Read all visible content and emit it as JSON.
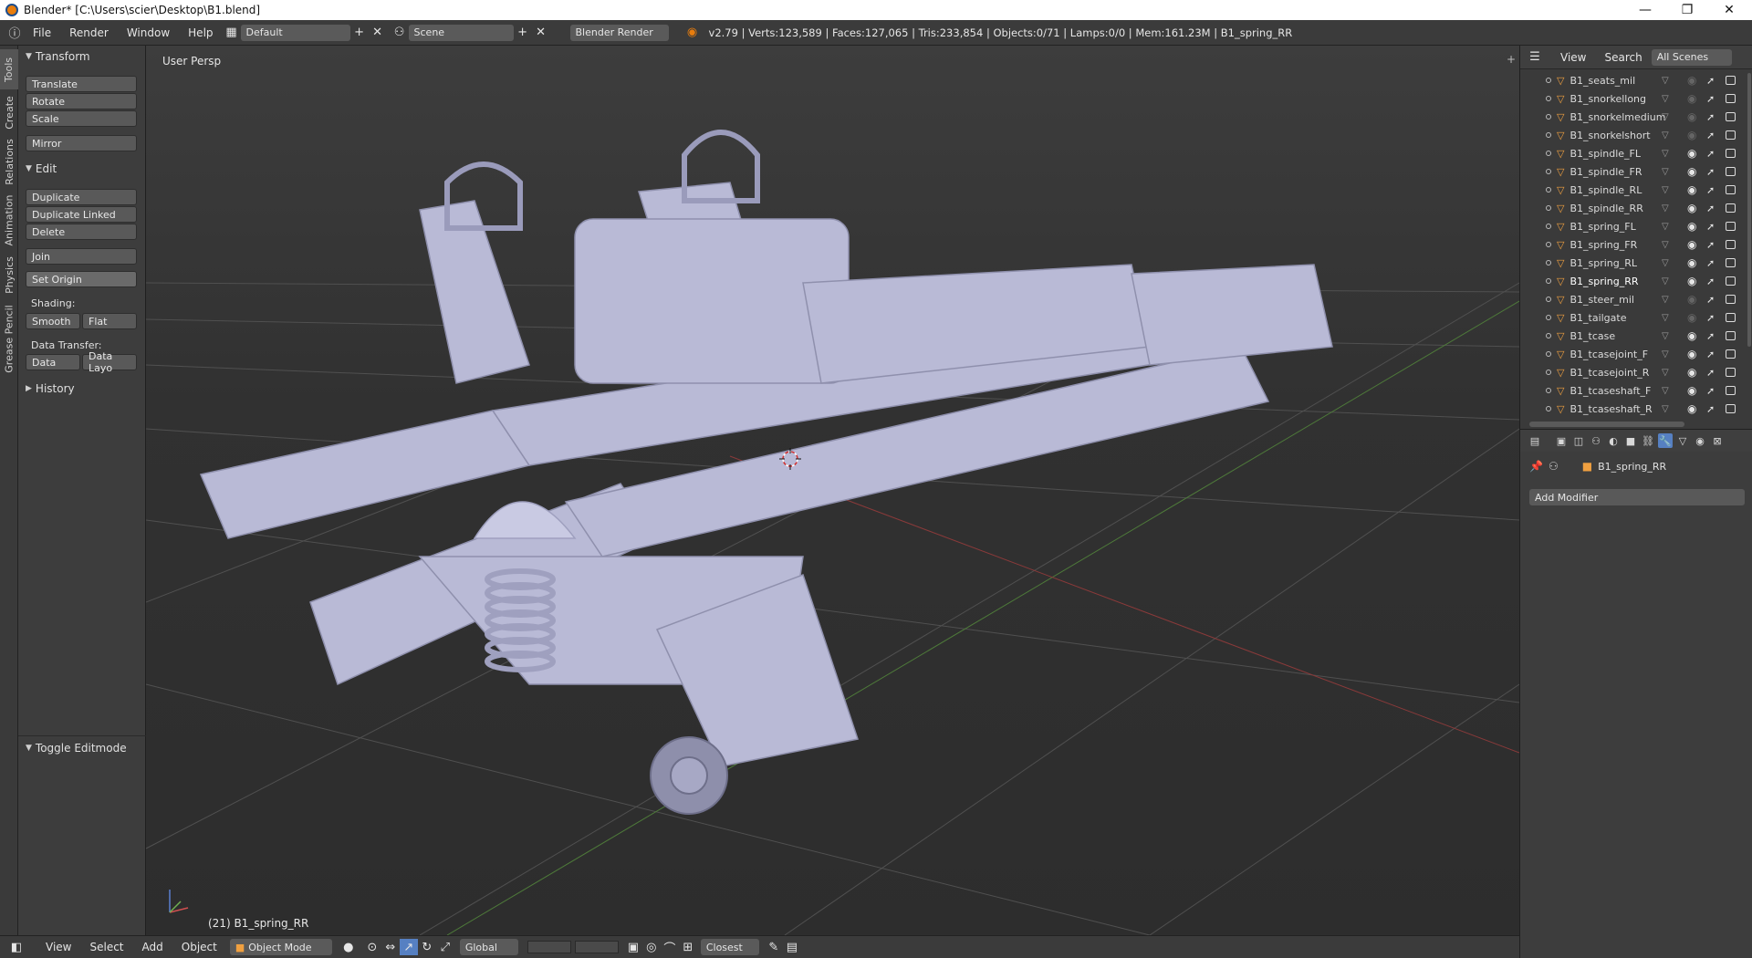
{
  "titlebar": {
    "title": "Blender* [C:\\Users\\scier\\Desktop\\B1.blend]",
    "minimize": "—",
    "restore": "❐",
    "close": "✕"
  },
  "infobar": {
    "menus": [
      "File",
      "Render",
      "Window",
      "Help"
    ],
    "layout": "Default",
    "scene": "Scene",
    "engine": "Blender Render",
    "stats": "v2.79 | Verts:123,589 | Faces:127,065 | Tris:233,854 | Objects:0/71 | Lamps:0/0 | Mem:161.23M | B1_spring_RR"
  },
  "tabs": [
    "Tools",
    "Create",
    "Relations",
    "Animation",
    "Physics",
    "Grease Pencil"
  ],
  "toolshelf": {
    "transform_title": "Transform",
    "translate": "Translate",
    "rotate": "Rotate",
    "scale": "Scale",
    "mirror": "Mirror",
    "edit_title": "Edit",
    "duplicate": "Duplicate",
    "duplicate_linked": "Duplicate Linked",
    "delete": "Delete",
    "join": "Join",
    "set_origin": "Set Origin",
    "shading_label": "Shading:",
    "smooth": "Smooth",
    "flat": "Flat",
    "data_transfer_label": "Data Transfer:",
    "data": "Data",
    "data_layo": "Data Layo",
    "history_title": "History",
    "toggle_editmode": "Toggle Editmode"
  },
  "viewport": {
    "view_label": "User Persp",
    "object_label": "(21) B1_spring_RR"
  },
  "bottombar": {
    "menus": [
      "View",
      "Select",
      "Add",
      "Object"
    ],
    "mode": "Object Mode",
    "orientation": "Global",
    "snap": "Closest"
  },
  "outliner": {
    "header": {
      "view": "View",
      "search": "Search",
      "scenes": "All Scenes"
    },
    "rows": [
      {
        "name": "B1_seats_mil",
        "visible": false
      },
      {
        "name": "B1_snorkellong",
        "visible": false
      },
      {
        "name": "B1_snorkelmedium",
        "visible": false
      },
      {
        "name": "B1_snorkelshort",
        "visible": false
      },
      {
        "name": "B1_spindle_FL",
        "visible": true
      },
      {
        "name": "B1_spindle_FR",
        "visible": true
      },
      {
        "name": "B1_spindle_RL",
        "visible": true
      },
      {
        "name": "B1_spindle_RR",
        "visible": true
      },
      {
        "name": "B1_spring_FL",
        "visible": true
      },
      {
        "name": "B1_spring_FR",
        "visible": true
      },
      {
        "name": "B1_spring_RL",
        "visible": true
      },
      {
        "name": "B1_spring_RR",
        "visible": true,
        "selected": true
      },
      {
        "name": "B1_steer_mil",
        "visible": false
      },
      {
        "name": "B1_tailgate",
        "visible": false
      },
      {
        "name": "B1_tcase",
        "visible": true
      },
      {
        "name": "B1_tcasejoint_F",
        "visible": true
      },
      {
        "name": "B1_tcasejoint_R",
        "visible": true
      },
      {
        "name": "B1_tcaseshaft_F",
        "visible": true
      },
      {
        "name": "B1_tcaseshaft_R",
        "visible": true
      }
    ]
  },
  "properties": {
    "object_name": "B1_spring_RR",
    "add_modifier": "Add Modifier"
  },
  "colors": {
    "accent": "#5680c2",
    "selected_text": "#ffffff",
    "object_icon": "#f0a040"
  }
}
